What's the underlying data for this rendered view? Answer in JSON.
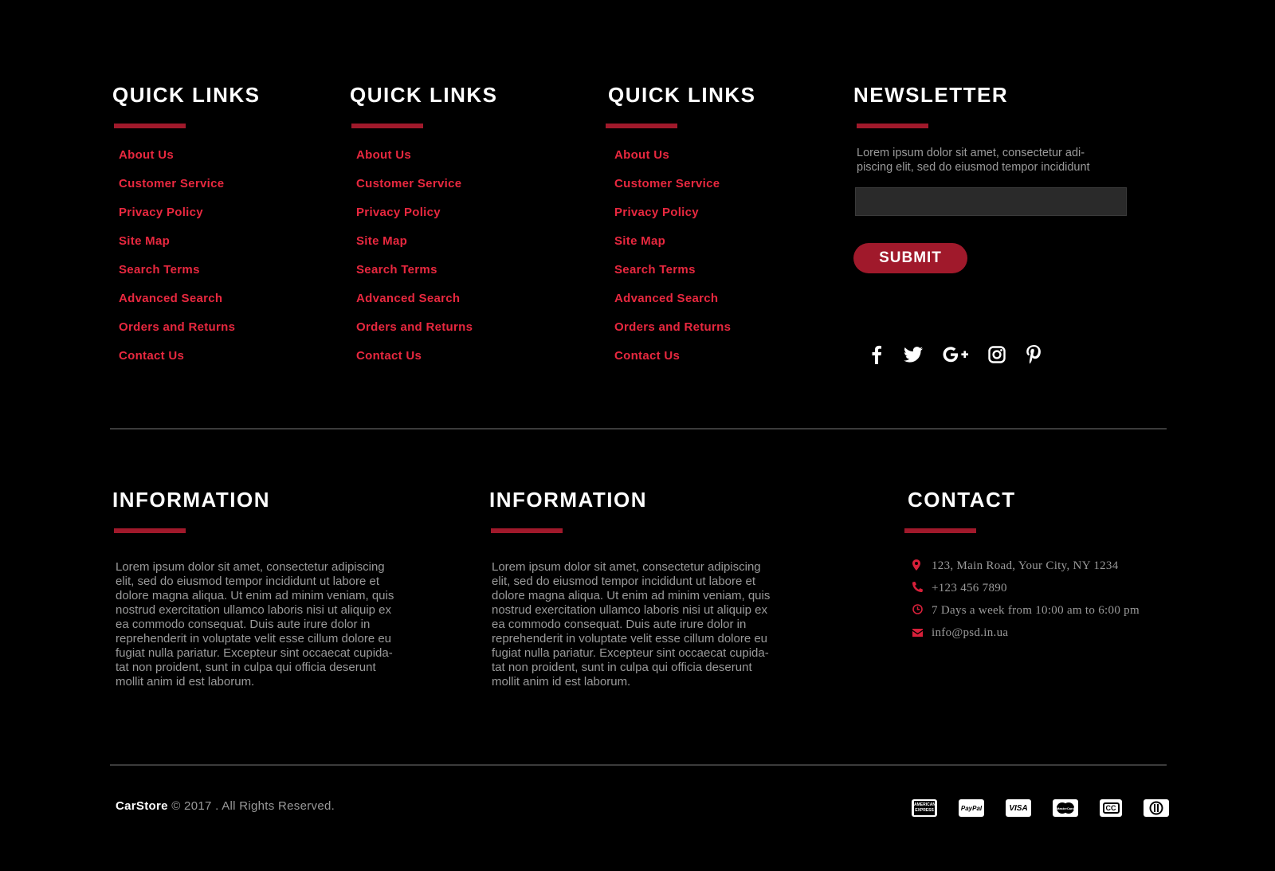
{
  "colors": {
    "background": "#000000",
    "accent": "#a0192b",
    "link": "#e8283f",
    "text_muted": "#9a9a9a"
  },
  "quick_links": [
    {
      "title": "QUICK LINKS",
      "items": [
        "About Us",
        "Customer Service",
        "Privacy Policy",
        "Site Map",
        "Search Terms",
        "Advanced Search",
        "Orders and Returns",
        "Contact Us"
      ]
    },
    {
      "title": "QUICK LINKS",
      "items": [
        "About Us",
        "Customer Service",
        "Privacy Policy",
        "Site Map",
        "Search Terms",
        "Advanced Search",
        "Orders and Returns",
        "Contact Us"
      ]
    },
    {
      "title": "QUICK LINKS",
      "items": [
        "About Us",
        "Customer Service",
        "Privacy Policy",
        "Site Map",
        "Search Terms",
        "Advanced Search",
        "Orders and Returns",
        "Contact Us"
      ]
    }
  ],
  "newsletter": {
    "title": "NEWSLETTER",
    "text_line1": "Lorem ipsum dolor sit amet, consectetur adi-",
    "text_line2": "piscing elit, sed do eiusmod tempor incididunt",
    "input_value": "",
    "input_placeholder": "",
    "submit_label": "SUBMIT",
    "social_icons": [
      "facebook-icon",
      "twitter-icon",
      "google-plus-icon",
      "instagram-icon",
      "pinterest-icon"
    ]
  },
  "information": [
    {
      "title": "INFORMATION",
      "lines": [
        "Lorem ipsum dolor sit amet, consectetur adipiscing",
        "elit, sed do eiusmod tempor incididunt ut labore et",
        "dolore magna aliqua. Ut enim ad minim veniam, quis",
        "nostrud exercitation ullamco laboris nisi ut aliquip ex",
        "ea commodo consequat. Duis aute irure dolor in",
        "reprehenderit in voluptate velit esse cillum dolore eu",
        "fugiat nulla pariatur. Excepteur sint occaecat cupida-",
        "tat non proident, sunt in culpa qui officia deserunt",
        "mollit anim id est laborum."
      ]
    },
    {
      "title": "INFORMATION",
      "lines": [
        "Lorem ipsum dolor sit amet, consectetur adipiscing",
        "elit, sed do eiusmod tempor incididunt ut labore et",
        "dolore magna aliqua. Ut enim ad minim veniam, quis",
        "nostrud exercitation ullamco laboris nisi ut aliquip ex",
        "ea commodo consequat. Duis aute irure dolor in",
        "reprehenderit in voluptate velit esse cillum dolore eu",
        "fugiat nulla pariatur. Excepteur sint occaecat cupida-",
        "tat non proident, sunt in culpa qui officia deserunt",
        "mollit anim id est laborum."
      ]
    }
  ],
  "contact": {
    "title": "CONTACT",
    "items": [
      {
        "icon": "map-pin-icon",
        "text": "123, Main Road, Your City, NY 1234"
      },
      {
        "icon": "phone-icon",
        "text": "+123 456 7890"
      },
      {
        "icon": "clock-icon",
        "text": "7 Days a week from 10:00 am to 6:00 pm"
      },
      {
        "icon": "envelope-icon",
        "text": "info@psd.in.ua"
      }
    ]
  },
  "footer": {
    "brand": "CarStore",
    "copyright": " © 2017 . All Rights Reserved.",
    "payment_icons": [
      "american-express-icon",
      "paypal-icon",
      "visa-icon",
      "mastercard-icon",
      "cc-icon",
      "diners-club-icon"
    ],
    "payment_labels": {
      "amex": "AMERICAN EXPRESS",
      "paypal": "PayPal",
      "visa": "VISA",
      "mastercard": "MasterCard",
      "cc": "CC"
    }
  }
}
